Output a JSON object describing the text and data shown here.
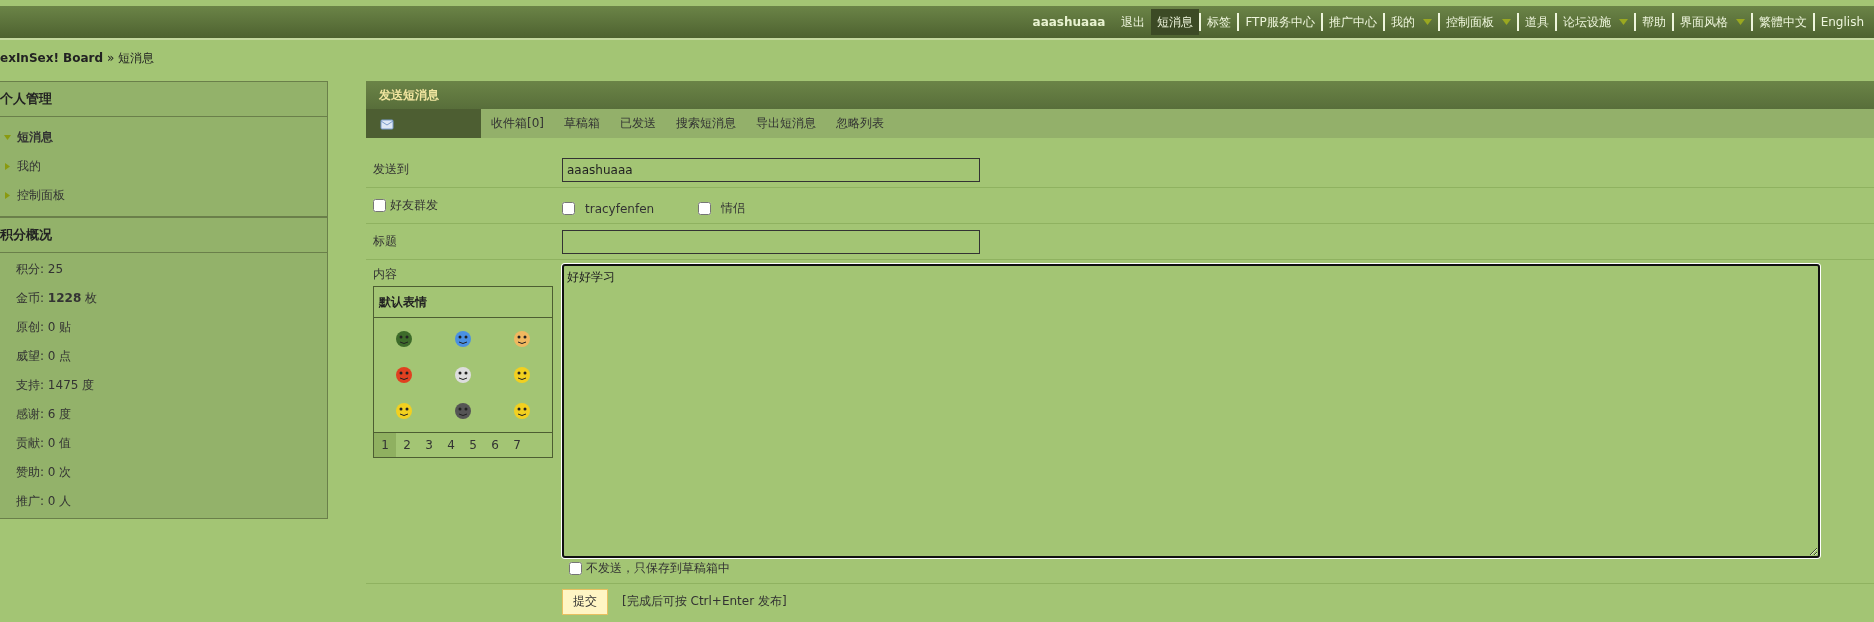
{
  "top_nav": {
    "user": "aaashuaaa",
    "items": [
      {
        "label": "退出",
        "selected": false,
        "has_menu": false
      },
      {
        "label": "短消息",
        "selected": true,
        "has_menu": false
      },
      {
        "label": "标签",
        "selected": false,
        "has_menu": false
      },
      {
        "label": "FTP服务中心",
        "selected": false,
        "has_menu": false
      },
      {
        "label": "推广中心",
        "selected": false,
        "has_menu": false
      },
      {
        "label": "我的",
        "selected": false,
        "has_menu": true
      },
      {
        "label": "控制面板",
        "selected": false,
        "has_menu": true
      },
      {
        "label": "道具",
        "selected": false,
        "has_menu": false
      },
      {
        "label": "论坛设施",
        "selected": false,
        "has_menu": true
      },
      {
        "label": "帮助",
        "selected": false,
        "has_menu": false
      },
      {
        "label": "界面风格",
        "selected": false,
        "has_menu": true
      },
      {
        "label": "繁體中文",
        "selected": false,
        "has_menu": false
      },
      {
        "label": "English",
        "selected": false,
        "has_menu": false
      }
    ]
  },
  "breadcrumb": {
    "board": "exInSex! Board",
    "separator": "»",
    "current": "短消息"
  },
  "sidebar": {
    "title": "个人管理",
    "items": [
      {
        "label": "短消息",
        "expanded": true
      },
      {
        "label": "我的",
        "expanded": false
      },
      {
        "label": "控制面板",
        "expanded": false
      }
    ],
    "stats_title": "积分概况",
    "stats": [
      "积分: 25",
      "金币: **1228** 枚",
      "原创: 0 贴",
      "威望: 0 点",
      "支持: 1475 度",
      "感谢: 6 度",
      "贡献: 0 值",
      "赞助: 0 次",
      "推广: 0 人"
    ]
  },
  "panel": {
    "title": "发送短消息",
    "tabs": [
      {
        "label": "收件箱[0]",
        "selected": false
      },
      {
        "label": "草稿箱",
        "selected": false
      },
      {
        "label": "已发送",
        "selected": false
      },
      {
        "label": "搜索短消息",
        "selected": false
      },
      {
        "label": "导出短消息",
        "selected": false
      },
      {
        "label": "忽略列表",
        "selected": false
      }
    ]
  },
  "form": {
    "to_label": "发送到",
    "to_value": "aaashuaaa",
    "group_send": {
      "label": "好友群发",
      "checked": false
    },
    "friends": [
      {
        "label": "tracyfenfen",
        "checked": false
      },
      {
        "label": "情侣",
        "checked": false
      }
    ],
    "subject_label": "标题",
    "content_label": "内容",
    "content_value": "好好学习",
    "smilies": {
      "title": "默认表情",
      "pages": [
        {
          "label": "1",
          "selected": true
        },
        {
          "label": "2",
          "selected": false
        },
        {
          "label": "3",
          "selected": false
        },
        {
          "label": "4",
          "selected": false
        },
        {
          "label": "5",
          "selected": false
        },
        {
          "label": "6",
          "selected": false
        },
        {
          "label": "7",
          "selected": false
        }
      ]
    },
    "draft_only": {
      "label": "不发送，只保存到草稿箱中",
      "checked": false
    },
    "submit": "提交",
    "hint": "[完成后可按 Ctrl+Enter 发布]"
  }
}
